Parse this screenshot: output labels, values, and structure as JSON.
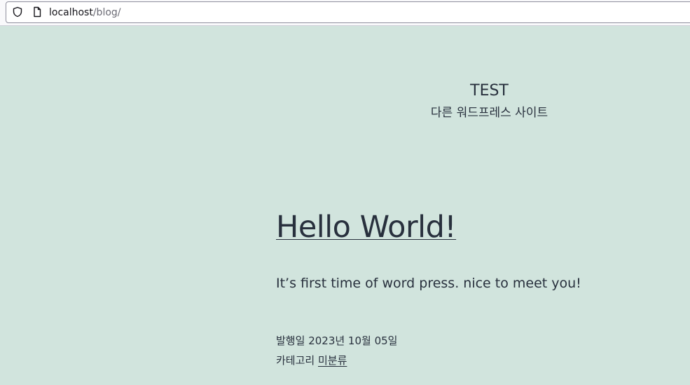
{
  "browser": {
    "url_host": "localhost",
    "url_path": "/blog/",
    "icons": [
      "shield-icon",
      "page-icon"
    ]
  },
  "site": {
    "title": "TEST",
    "description": "다른 워드프레스 사이트"
  },
  "post": {
    "title": "Hello World!",
    "excerpt": "It’s first time of word press. nice to meet you!",
    "published_label": "발행일",
    "published_date": "2023년 10월 05일",
    "category_label": "카테고리",
    "category": "미분류"
  },
  "colors": {
    "background": "#d1e4dd",
    "text": "#28303d"
  }
}
